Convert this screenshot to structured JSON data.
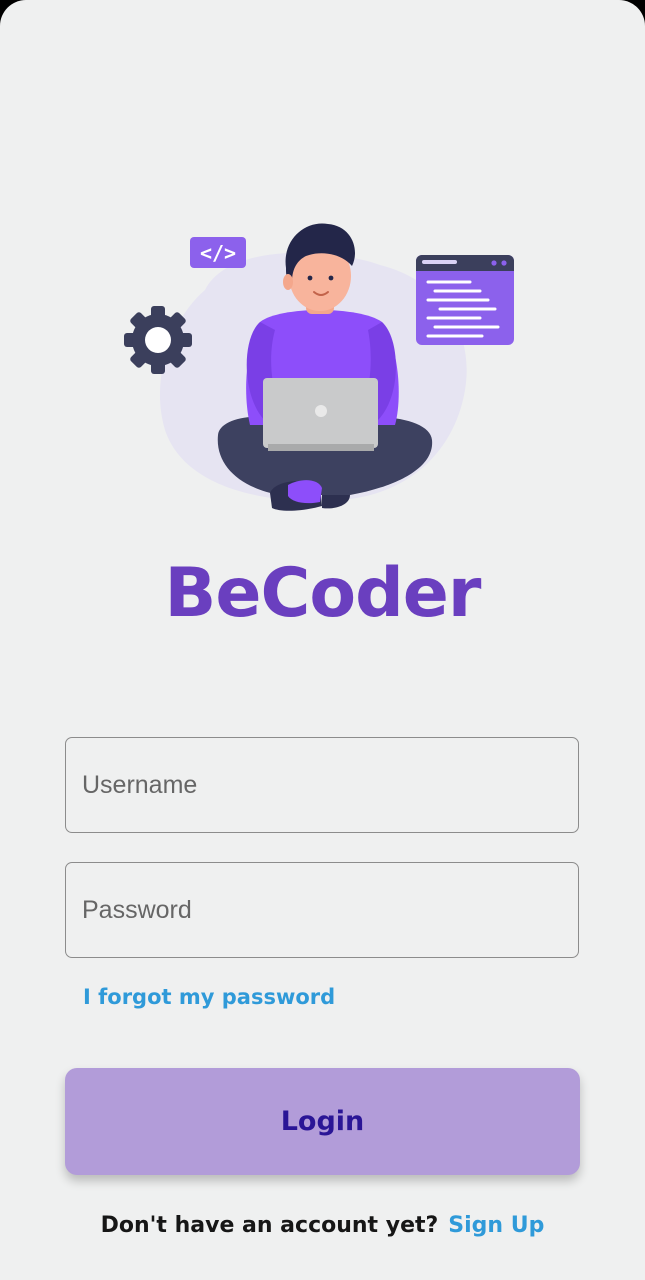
{
  "app": {
    "name": "BeCoder"
  },
  "illustration": {
    "icons": [
      "code-tag-icon",
      "gear-icon",
      "browser-window-icon",
      "developer-illustration"
    ],
    "code_tag_text": "</>"
  },
  "form": {
    "username": {
      "placeholder": "Username",
      "value": ""
    },
    "password": {
      "placeholder": "Password",
      "value": ""
    },
    "forgot_label": "I forgot my password",
    "login_label": "Login"
  },
  "footer": {
    "prompt": "Don't have an account yet?",
    "signup_label": "Sign Up"
  },
  "colors": {
    "background": "#eff0f0",
    "brand": "#6a3fbf",
    "link": "#2f9ad9",
    "button": "#b29cd9",
    "button_text": "#2a1596",
    "illustration_purple": "#8d4efa",
    "illustration_dark": "#3b3f5c"
  }
}
